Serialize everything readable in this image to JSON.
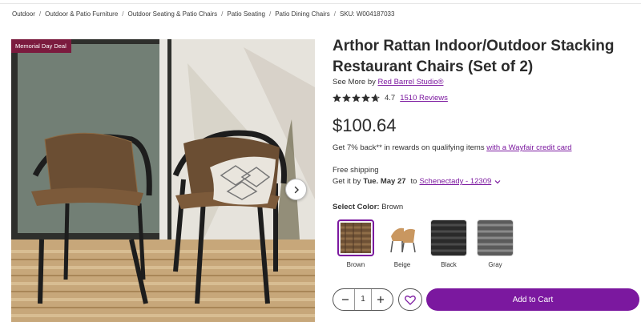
{
  "breadcrumb": {
    "items": [
      "Outdoor",
      "Outdoor & Patio Furniture",
      "Outdoor Seating & Patio Chairs",
      "Patio Seating",
      "Patio Dining Chairs"
    ],
    "separator": "/",
    "sku": "SKU: W004187033"
  },
  "gallery": {
    "badge": "Memorial Day Deal",
    "next_icon": "chevron-right-icon"
  },
  "product": {
    "title": "Arthor Rattan Indoor/Outdoor Stacking Restaurant Chairs (Set of 2)",
    "see_more_prefix": "See More by",
    "brand": "Red Barrel Studio®",
    "rating": "4.7",
    "rating_value": 4.7,
    "reviews": "1510 Reviews",
    "price": "$100.64"
  },
  "rewards": {
    "text": "Get 7% back** in rewards on qualifying items",
    "link": "with a Wayfair credit card"
  },
  "shipping": {
    "label": "Free shipping",
    "prefix": "Get it by",
    "date": "Tue. May 27",
    "to": "to",
    "location": "Schenectady - 12309"
  },
  "color": {
    "label": "Select Color:",
    "selected": "Brown",
    "options": [
      "Brown",
      "Beige",
      "Black",
      "Gray"
    ]
  },
  "cart": {
    "quantity": "1",
    "add_label": "Add to Cart"
  },
  "colors": {
    "accent": "#7b189f",
    "badge": "#7b1b3e"
  }
}
